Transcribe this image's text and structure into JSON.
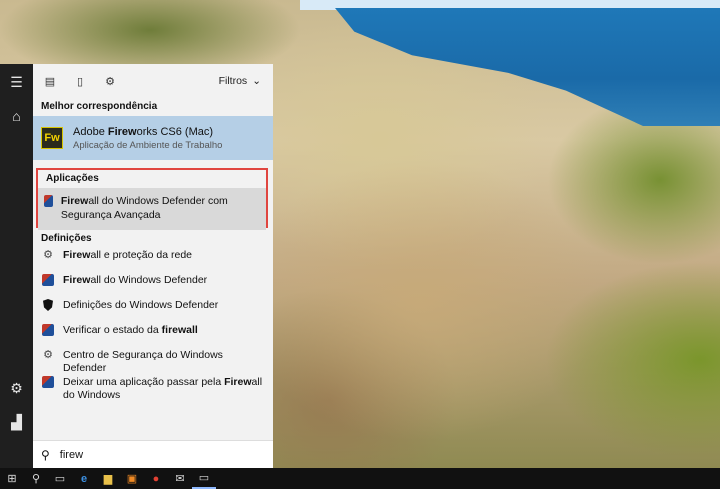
{
  "search": {
    "filters_label": "Filtros",
    "query": "firew"
  },
  "best_match": {
    "heading": "Melhor correspondência",
    "app_icon_text": "Fw",
    "title_pre": "Adobe ",
    "title_bold": "Firew",
    "title_post": "orks CS6 (Mac)",
    "subtitle": "Aplicação de Ambiente de Trabalho"
  },
  "applications": {
    "heading": "Aplicações",
    "item": {
      "bold": "Firew",
      "rest": "all do Windows Defender com Segurança Avançada"
    }
  },
  "definitions": {
    "heading": "Definições",
    "items": [
      {
        "pre": "",
        "bold": "Firew",
        "post": "all e proteção da rede",
        "icon": "gear-icon"
      },
      {
        "pre": "",
        "bold": "Firew",
        "post": "all do Windows Defender",
        "icon": "firewall-icon"
      },
      {
        "pre": "Definições do Windows Defender",
        "bold": "",
        "post": "",
        "icon": "defender-shield-icon"
      },
      {
        "pre": "Verificar o estado da ",
        "bold": "firewall",
        "post": "",
        "icon": "firewall-icon"
      },
      {
        "pre": "Centro de Segurança do Windows Defender",
        "bold": "",
        "post": "",
        "icon": "gear-icon"
      },
      {
        "pre": "Deixar uma aplicação passar pela ",
        "bold": "Firew",
        "post": "all do Windows",
        "icon": "firewall-icon"
      }
    ]
  },
  "colors": {
    "highlight": "#b5cfe6",
    "selection_border": "#e0453f",
    "rail": "#1f1f1f",
    "taskbar": "#111111"
  },
  "taskbar": {
    "icons": [
      "windows-start-icon",
      "search-icon",
      "task-view-icon",
      "edge-icon",
      "file-explorer-icon",
      "photos-icon",
      "chrome-icon",
      "mail-icon",
      "terminal-icon"
    ]
  }
}
